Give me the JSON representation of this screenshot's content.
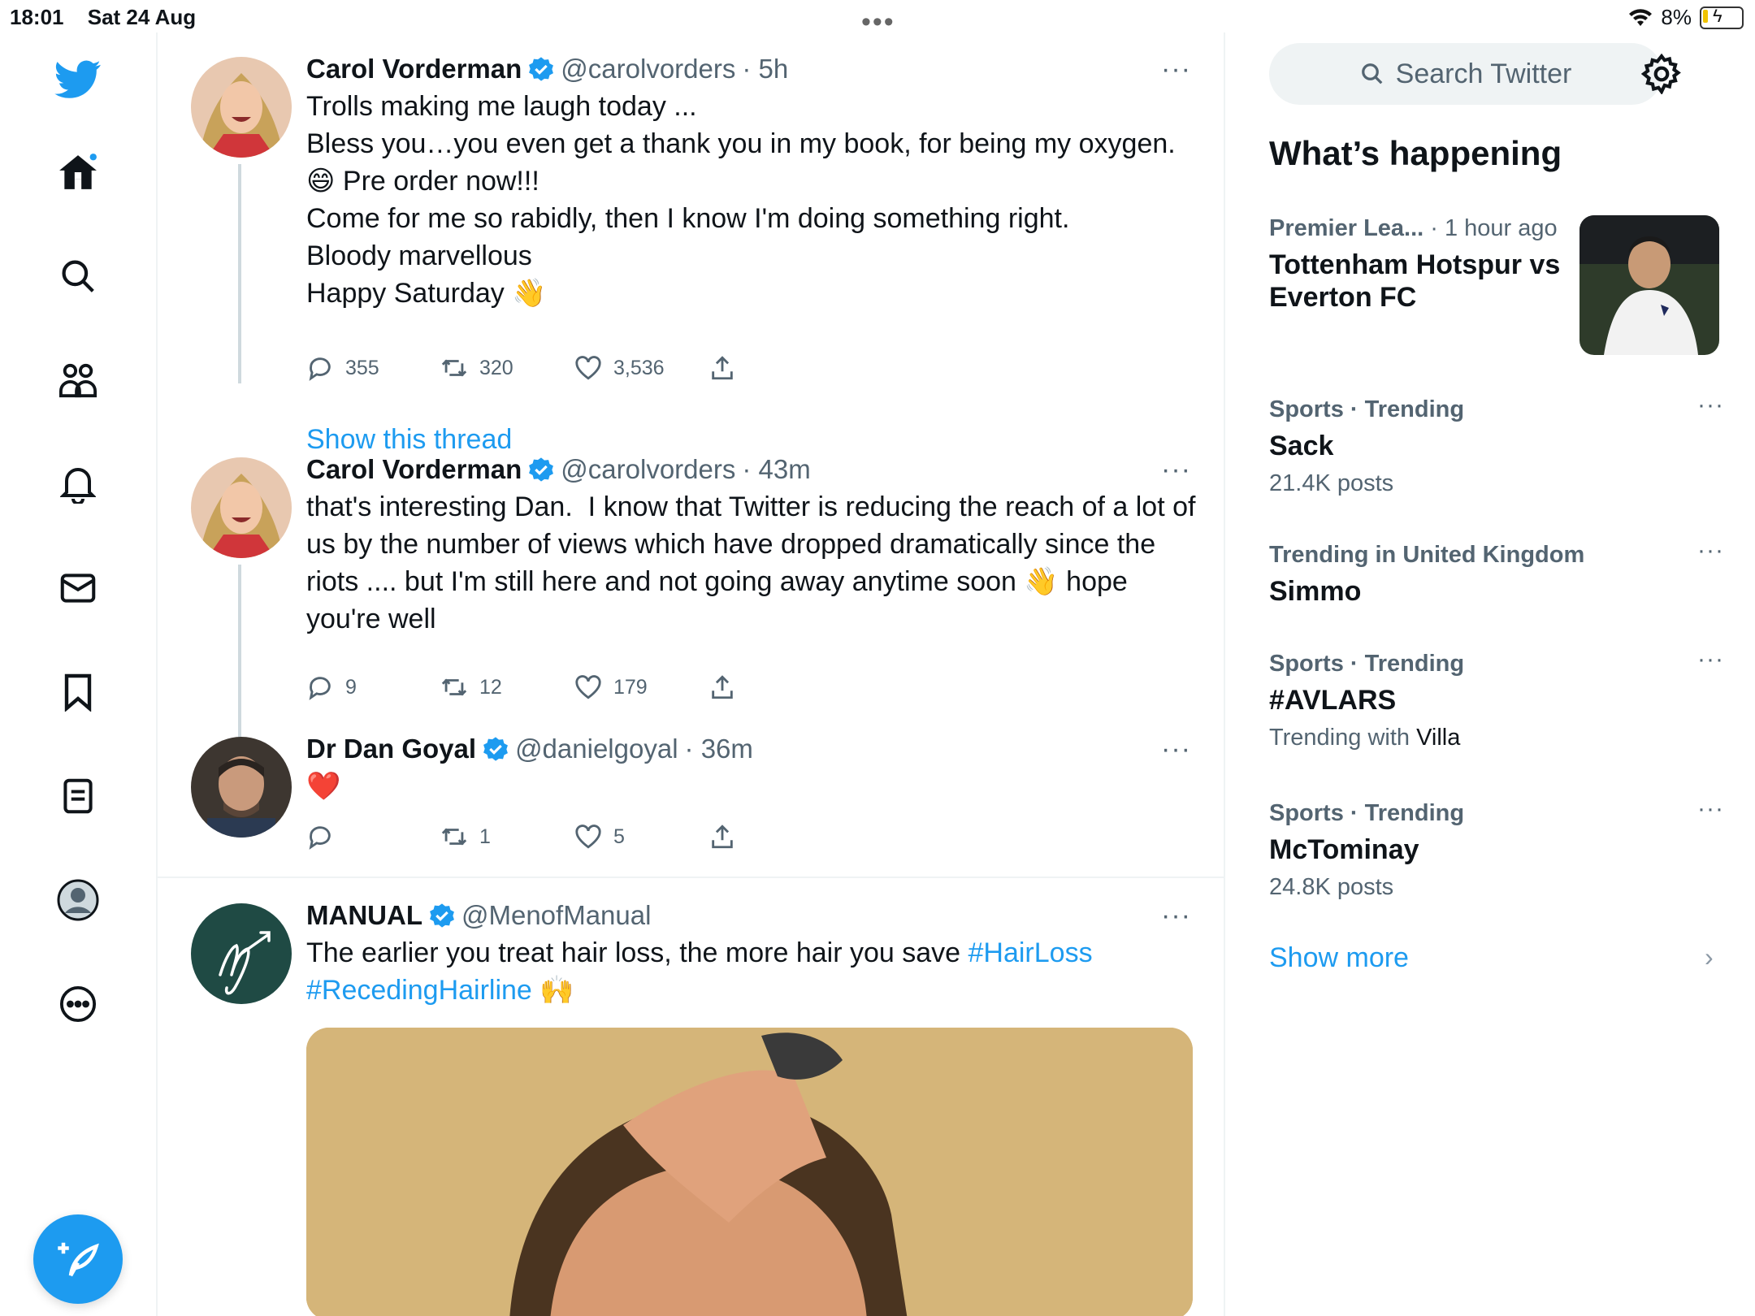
{
  "status": {
    "time": "18:01",
    "date": "Sat 24 Aug",
    "battery": "8%"
  },
  "multitask": "•••",
  "nav": {
    "items": [
      "twitter-logo",
      "home",
      "search",
      "communities",
      "notifications",
      "messages",
      "bookmarks",
      "lists",
      "profile",
      "more"
    ],
    "compose_label": "Tweet"
  },
  "tweets": [
    {
      "name": "Carol Vorderman",
      "handle": "@carolvorders",
      "time": "· 5h",
      "text": "Trolls making me laugh today ...\nBless you…you even get a thank you in my book, for being my oxygen.\n😄 Pre order now!!!\nCome for me so rabidly, then I know I'm doing something right.\nBloody marvellous\nHappy Saturday 👋",
      "replies": "355",
      "retweets": "320",
      "likes": "3,536"
    },
    {
      "name": "Carol Vorderman",
      "handle": "@carolvorders",
      "time": "· 43m",
      "text": "that's interesting Dan.  I know that Twitter is reducing the reach of a lot of us by the number of views which have dropped dramatically since the riots .... but I'm still here and not going away anytime soon 👋 hope you're well",
      "replies": "9",
      "retweets": "12",
      "likes": "179"
    },
    {
      "name": "Dr Dan Goyal",
      "handle": "@danielgoyal",
      "time": "· 36m",
      "text": "❤️",
      "replies": "",
      "retweets": "1",
      "likes": "5"
    },
    {
      "name": "MANUAL",
      "handle": "@MenofManual",
      "time": "",
      "text_plain": "The earlier you treat hair loss, the more hair you save ",
      "hashtag1": "#HairLoss",
      "hashtag2": "#RecedingHairline",
      "emoji": " 🙌"
    }
  ],
  "show_thread": "Show this thread",
  "more_dots": "···",
  "right": {
    "search_placeholder": "Search Twitter",
    "title": "What’s happening",
    "trends": [
      {
        "meta": "Premier Lea...",
        "meta_light": " · 1 hour ago",
        "name": "Tottenham Hotspur vs Everton FC",
        "sub": ""
      },
      {
        "meta": "Sports · Trending",
        "meta_light": "",
        "name": "Sack",
        "sub": "21.4K posts"
      },
      {
        "meta": "Trending in United Kingdom",
        "meta_light": "",
        "name": "Simmo",
        "sub": ""
      },
      {
        "meta": "Sports · Trending",
        "meta_light": "",
        "name": "#AVLARS",
        "sub_prefix": "Trending with ",
        "sub_strong": "Villa"
      },
      {
        "meta": "Sports · Trending",
        "meta_light": "",
        "name": "McTominay",
        "sub": "24.8K posts"
      }
    ],
    "show_more": "Show more",
    "chevron": "›"
  },
  "colors": {
    "accent": "#1d9bf0",
    "text": "#0f1419",
    "muted": "#536471"
  }
}
